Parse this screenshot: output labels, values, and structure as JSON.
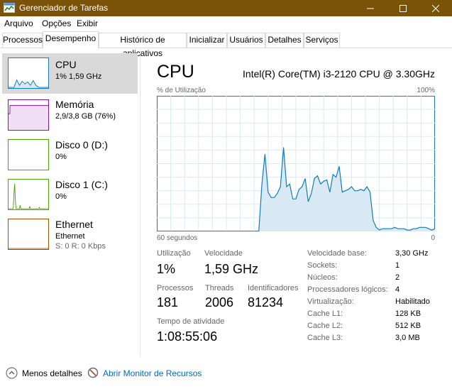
{
  "window": {
    "title": "Gerenciador de Tarefas"
  },
  "menu": [
    "Arquivo",
    "Opções",
    "Exibir"
  ],
  "tabs": [
    "Processos",
    "Desempenho",
    "Histórico de aplicativos",
    "Inicializar",
    "Usuários",
    "Detalhes",
    "Serviços"
  ],
  "sidebar": [
    {
      "name": "CPU",
      "value": "1% 1,59 GHz",
      "color": "#117dbb"
    },
    {
      "name": "Memória",
      "value": "2,9/3,8 GB (76%)",
      "color": "#8b12ae"
    },
    {
      "name": "Disco 0 (D:)",
      "value": "0%",
      "color": "#4da60c"
    },
    {
      "name": "Disco 1 (C:)",
      "value": "0%",
      "color": "#4da60c"
    },
    {
      "name": "Ethernet",
      "sub": "Ethernet",
      "value": "S: 0 R: 0 Kbps",
      "color": "#a74f01"
    }
  ],
  "cpu": {
    "title": "CPU",
    "model": "Intel(R) Core(TM) i3-2120 CPU @ 3.30GHz",
    "util_label": "% de Utilização",
    "max_label": "100%",
    "time_label": "60 segundos",
    "min_label": "0"
  },
  "chart_data": {
    "type": "area",
    "ylim": [
      0,
      100
    ],
    "series": [
      {
        "values": [
          0,
          0,
          0,
          0,
          0,
          0,
          0,
          0,
          0,
          0,
          0,
          0,
          0,
          0,
          0,
          0,
          0,
          0,
          0,
          0,
          0,
          0,
          0,
          0,
          0,
          0,
          0,
          0,
          0,
          0,
          0,
          0,
          0,
          0,
          35,
          57,
          29,
          25,
          25,
          28,
          33,
          62,
          33,
          35,
          24,
          24,
          31,
          33,
          39,
          22,
          28,
          39,
          41,
          35,
          37,
          38,
          29,
          42,
          40,
          48,
          29,
          30,
          31,
          33,
          30,
          30,
          31,
          30,
          33,
          29,
          8,
          3,
          1,
          2,
          2,
          2,
          2,
          3,
          2,
          2,
          2,
          1,
          1,
          2,
          2,
          3,
          3,
          3,
          2,
          1,
          2
        ]
      }
    ]
  },
  "stats": {
    "util_label": "Utilização",
    "util_value": "1%",
    "speed_label": "Velocidade",
    "speed_value": "1,59 GHz",
    "proc_label": "Processos",
    "proc_value": "181",
    "threads_label": "Threads",
    "threads_value": "2006",
    "ids_label": "Identificadores",
    "ids_value": "81234",
    "uptime_label": "Tempo de atividade",
    "uptime_value": "1:08:55:06"
  },
  "details": [
    {
      "label": "Velocidade base:",
      "value": "3,30 GHz"
    },
    {
      "label": "Sockets:",
      "value": "1"
    },
    {
      "label": "Núcleos:",
      "value": "2"
    },
    {
      "label": "Processadores lógicos:",
      "value": "4"
    },
    {
      "label": "Virtualização:",
      "value": "Habilitado"
    },
    {
      "label": "Cache L1:",
      "value": "128 KB"
    },
    {
      "label": "Cache L2:",
      "value": "512 KB"
    },
    {
      "label": "Cache L3:",
      "value": "3,0 MB"
    }
  ],
  "footer": {
    "less": "Menos detalhes",
    "monitor": "Abrir Monitor de Recursos"
  }
}
